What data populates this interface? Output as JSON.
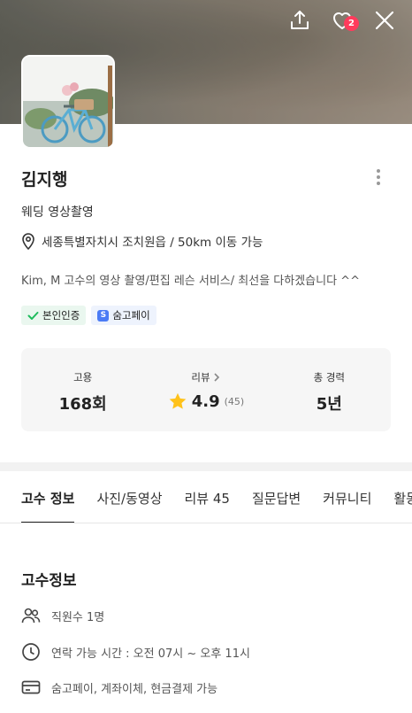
{
  "header": {
    "share_icon": "share-icon",
    "like_icon": "heart-icon",
    "like_count": "2",
    "close_icon": "close-icon"
  },
  "profile": {
    "name": "김지행",
    "category": "웨딩 영상촬영",
    "location": "세종특별자치시 조치원읍 / 50km 이동 가능",
    "intro": "Kim, M 고수의 영상 촬영/편집 레슨  서비스/ 최선을 다하겠습니다 ^^",
    "chips": {
      "verified": "본인인증",
      "pay": "숨고페이",
      "pay_logo": "S"
    }
  },
  "stats": {
    "hire_label": "고용",
    "hire_value": "168회",
    "review_label": "리뷰",
    "rating": "4.9",
    "review_count": "(45)",
    "career_label": "총 경력",
    "career_value": "5년"
  },
  "tabs": [
    {
      "label": "고수 정보",
      "active": true
    },
    {
      "label": "사진/동영상",
      "active": false
    },
    {
      "label": "리뷰 45",
      "active": false
    },
    {
      "label": "질문답변",
      "active": false
    },
    {
      "label": "커뮤니티",
      "active": false
    },
    {
      "label": "활동",
      "active": false
    }
  ],
  "info": {
    "title": "고수정보",
    "staff": "직원수 1명",
    "hours": "연락 가능 시간 : 오전 07시  ~ 오후 11시",
    "payment": "숨고페이, 계좌이체, 현금결제 가능"
  },
  "colors": {
    "star": "#ffc21a",
    "badge": "#ff3b5c",
    "verify_check": "#1dbb5c",
    "pay_brand": "#4b7bf5"
  }
}
